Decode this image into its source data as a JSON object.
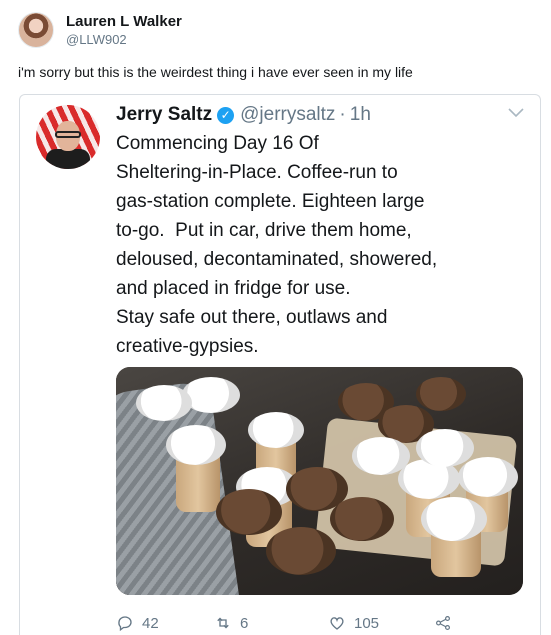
{
  "outer_tweet": {
    "author_name": "Lauren L Walker",
    "author_handle": "@LLW902",
    "text": "i'm sorry but this is the weirdest thing i have ever seen in my life"
  },
  "quoted_tweet": {
    "author_name": "Jerry Saltz",
    "author_handle": "@jerrysaltz",
    "separator": "·",
    "time": "1h",
    "text": "Commencing Day 16 Of\nSheltering-in-Place. Coffee-run to\ngas-station complete. Eighteen large\nto-go.  Put in car, drive them home,\ndeloused, decontaminated, showered,\nand placed in fridge for use.\nStay safe out there, outlaws and\ncreative-gypsies.",
    "actions": {
      "replies": "42",
      "retweets": "6",
      "likes": "105"
    }
  },
  "icons": {
    "verified": "verified-badge-icon",
    "chevron": "chevron-down-icon",
    "reply": "reply-icon",
    "retweet": "retweet-icon",
    "like": "heart-icon",
    "share": "share-icon"
  },
  "colors": {
    "text": "#14171a",
    "secondary": "#657786",
    "verified": "#1da1f2",
    "border": "#d8dde2"
  }
}
